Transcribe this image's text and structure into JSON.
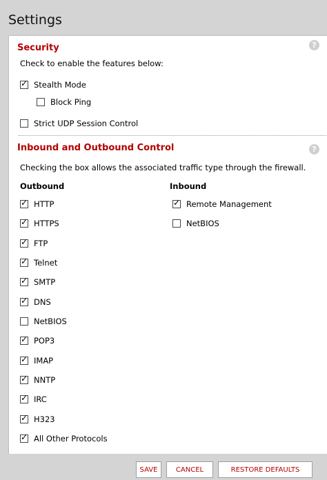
{
  "page": {
    "title": "Settings"
  },
  "security": {
    "title": "Security",
    "description": "Check to enable the features below:",
    "items": [
      {
        "label": "Stealth Mode",
        "checked": true
      },
      {
        "label": "Block Ping",
        "checked": false
      },
      {
        "label": "Strict UDP Session Control",
        "checked": false
      }
    ]
  },
  "traffic": {
    "title": "Inbound and Outbound Control",
    "description": "Checking the box allows the associated traffic type through the firewall.",
    "outbound_label": "Outbound",
    "inbound_label": "Inbound",
    "outbound": [
      {
        "label": "HTTP",
        "checked": true
      },
      {
        "label": "HTTPS",
        "checked": true
      },
      {
        "label": "FTP",
        "checked": true
      },
      {
        "label": "Telnet",
        "checked": true
      },
      {
        "label": "SMTP",
        "checked": true
      },
      {
        "label": "DNS",
        "checked": true
      },
      {
        "label": "NetBIOS",
        "checked": false
      },
      {
        "label": "POP3",
        "checked": true
      },
      {
        "label": "IMAP",
        "checked": true
      },
      {
        "label": "NNTP",
        "checked": true
      },
      {
        "label": "IRC",
        "checked": true
      },
      {
        "label": "H323",
        "checked": true
      },
      {
        "label": "All Other Protocols",
        "checked": true
      }
    ],
    "inbound": [
      {
        "label": "Remote Management",
        "checked": true
      },
      {
        "label": "NetBIOS",
        "checked": false
      }
    ]
  },
  "help_icon": "?",
  "buttons": {
    "save": "SAVE",
    "cancel": "CANCEL",
    "restore": "RESTORE DEFAULTS"
  },
  "colors": {
    "accent": "#b30000",
    "background": "#d4d4d4",
    "panel": "#ffffff"
  }
}
